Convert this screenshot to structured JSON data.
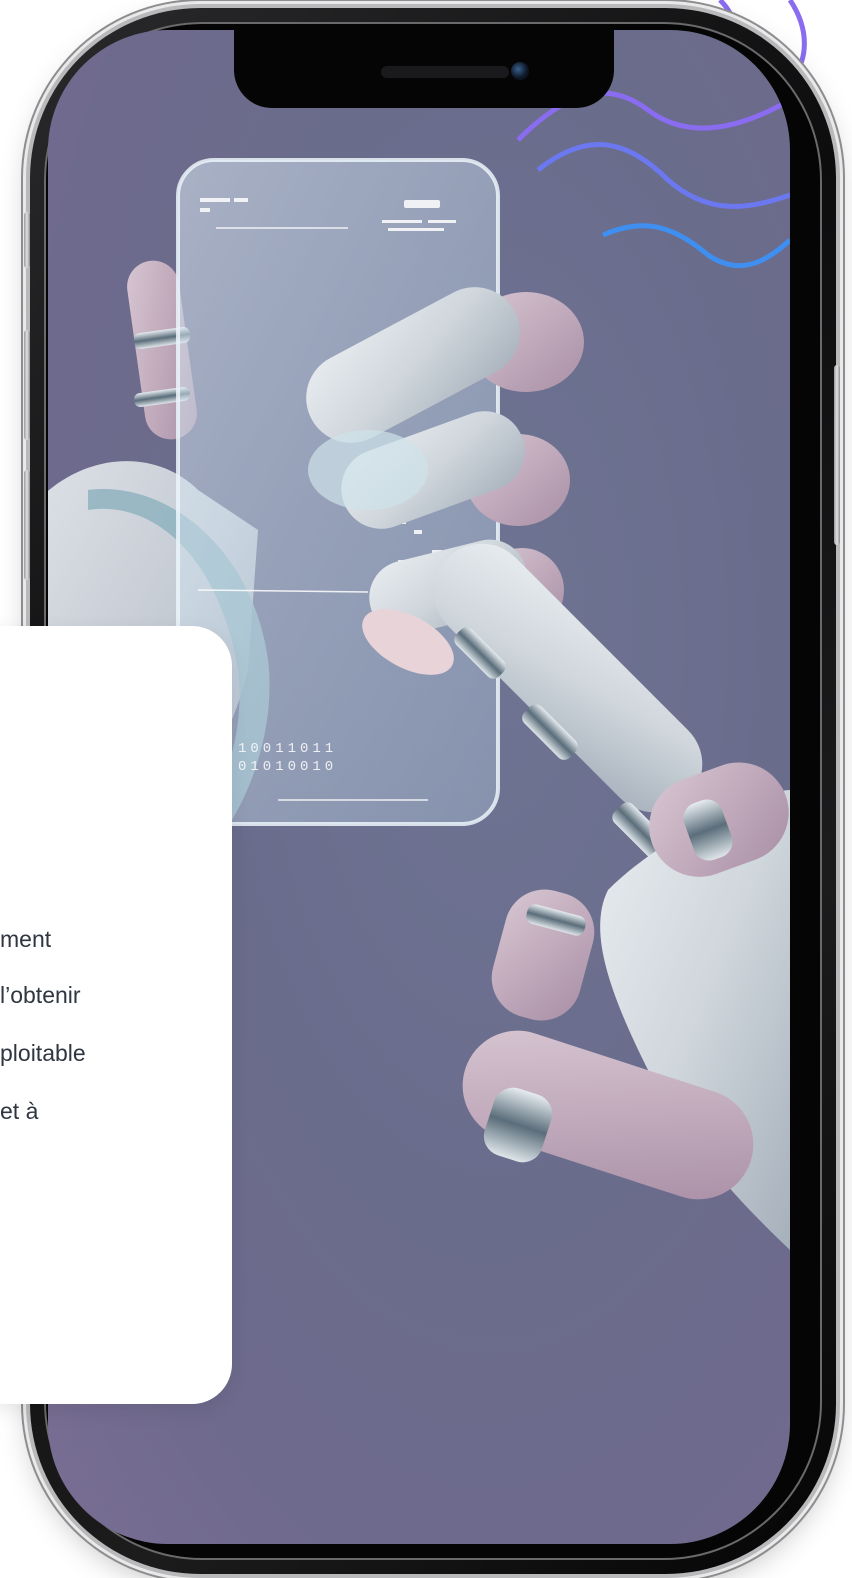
{
  "colors": {
    "screen_background": "#6c6e8e",
    "wave_top": "#8a6cf0",
    "wave_bottom": "#3e8ff0",
    "card_background": "#ffffff",
    "card_text": "#2f3640",
    "phone_frame": "#0d0d0e"
  },
  "illustration": {
    "subject": "robot-hands-holding-transparent-phone",
    "screen_digits_line1": "10011011",
    "screen_digits_line2": "01010010"
  },
  "card": {
    "lines": [
      "ment",
      "l’obtenir",
      "ploitable",
      "et à"
    ]
  }
}
